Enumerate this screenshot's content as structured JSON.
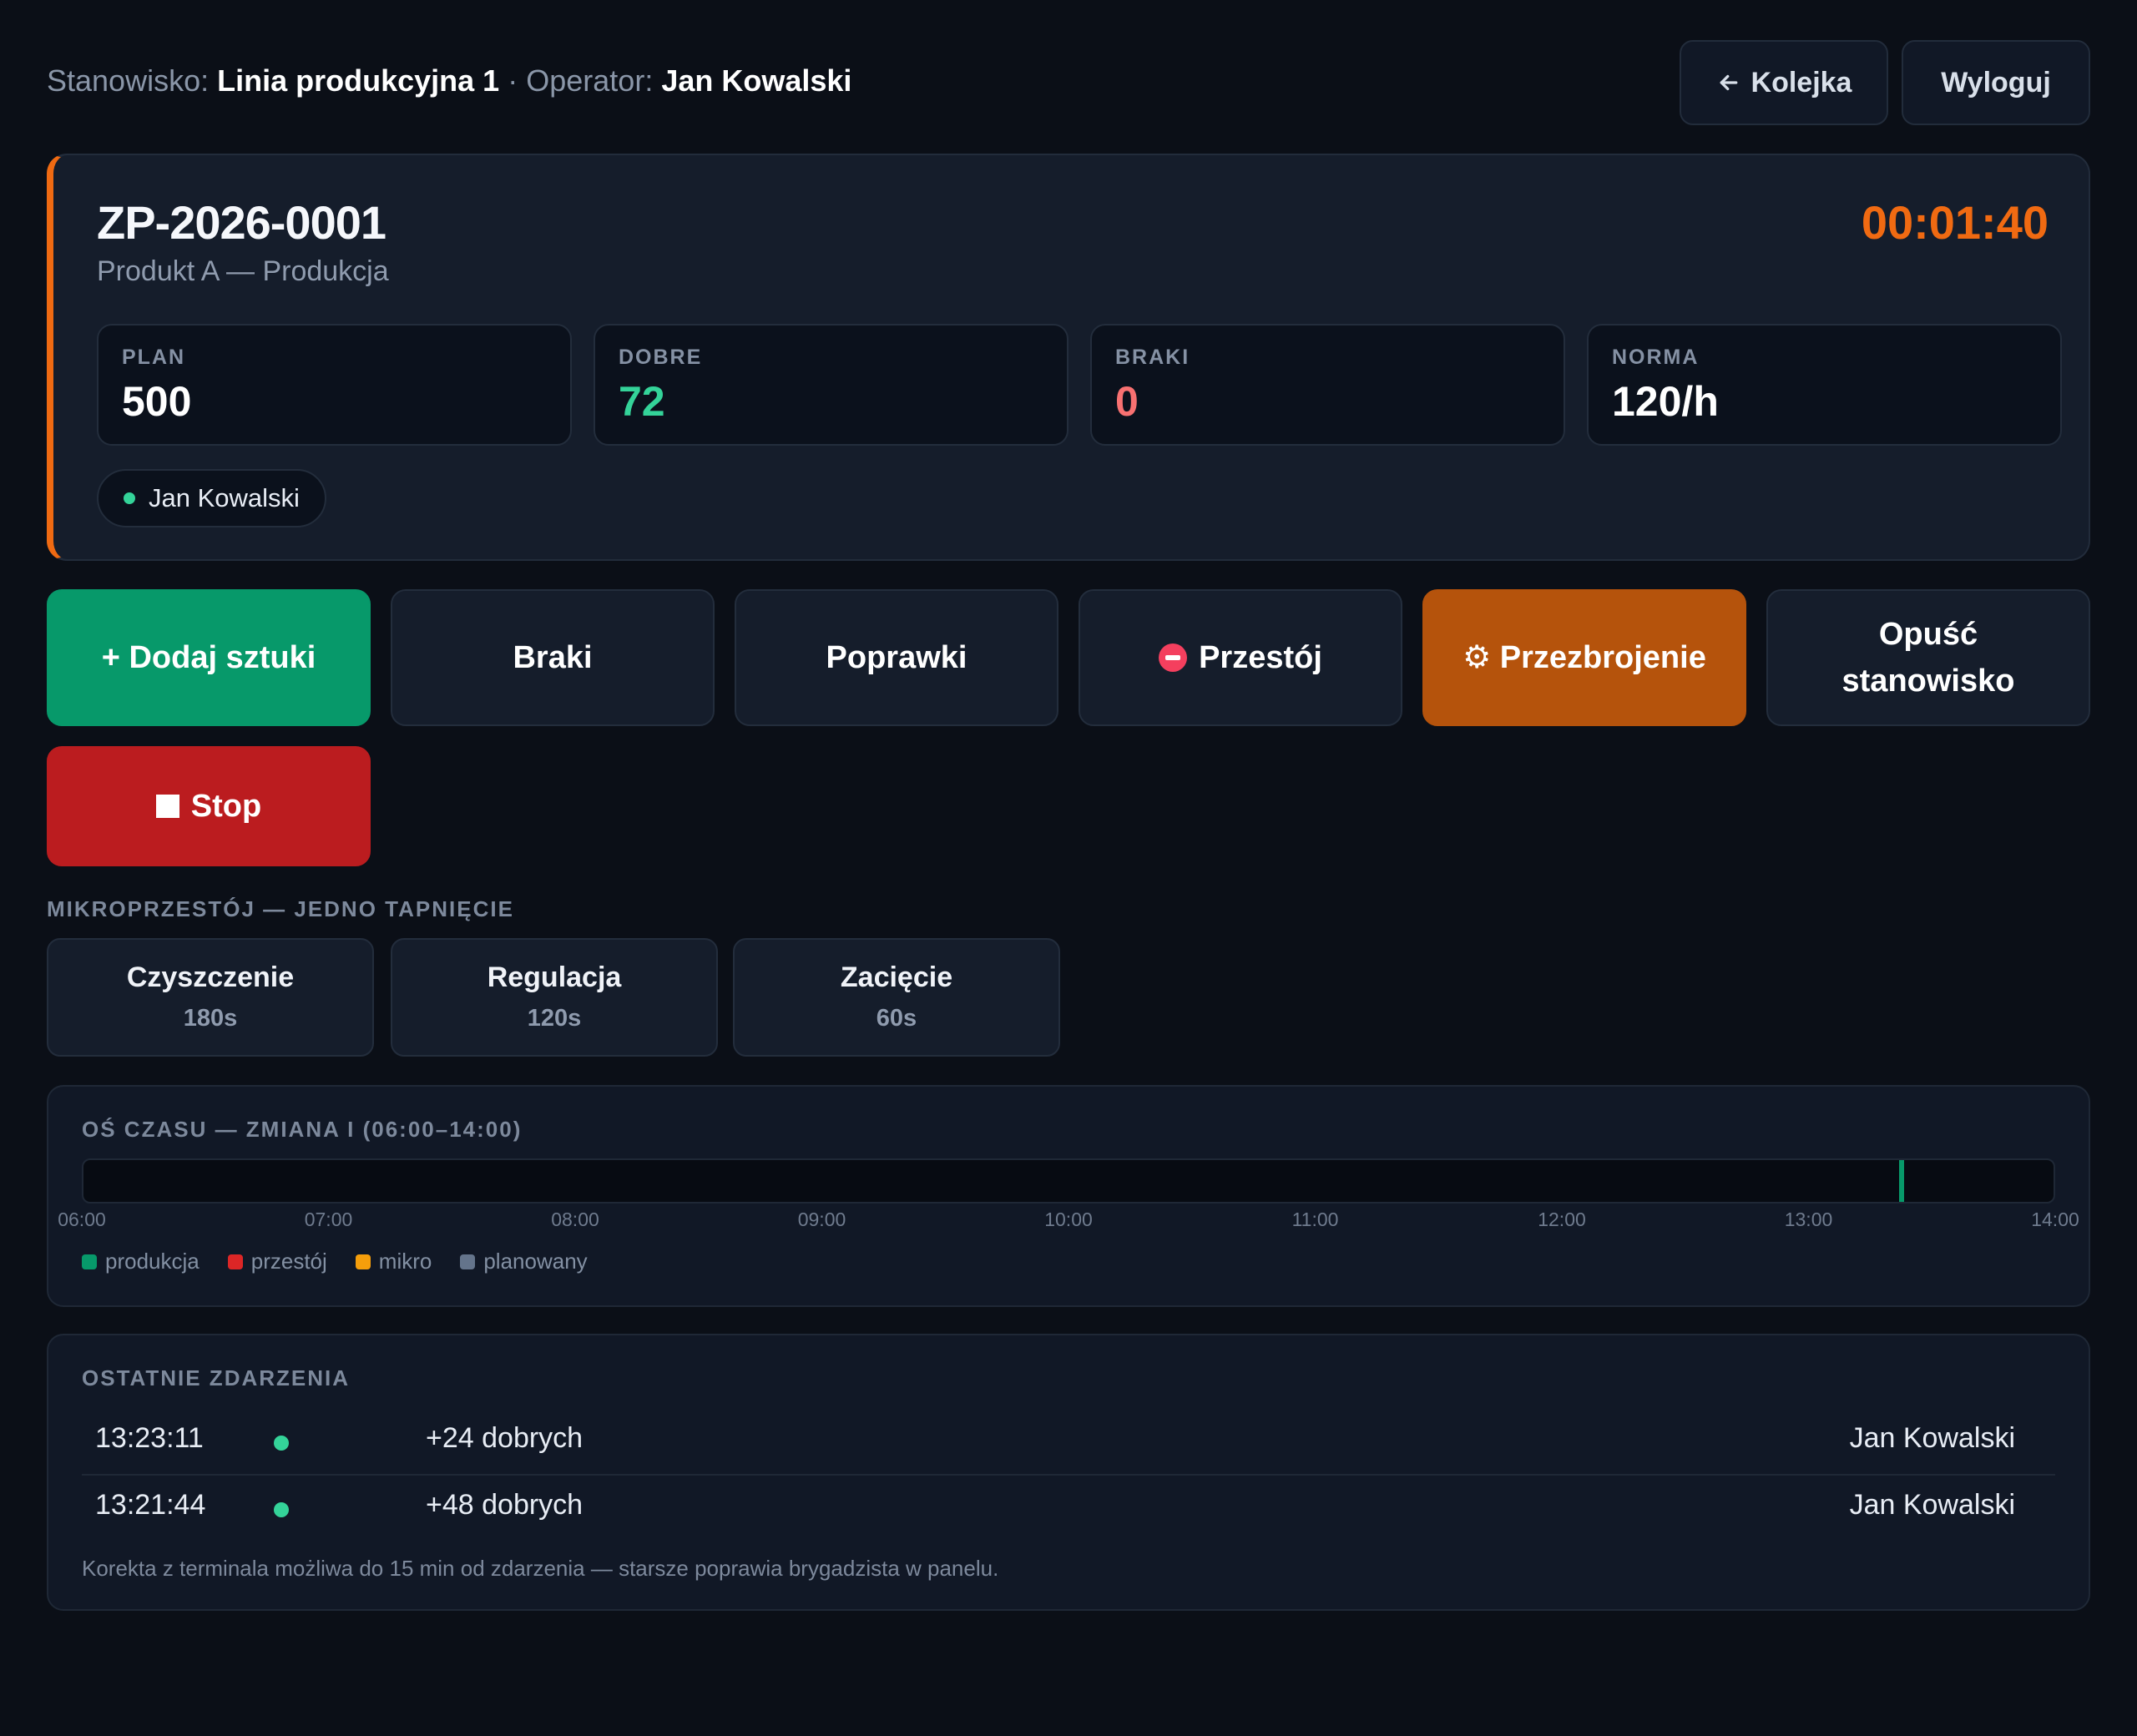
{
  "header": {
    "station_label": "Stanowisko:",
    "station_name": "Linia produkcyjna 1",
    "separator": "·",
    "operator_label": "Operator:",
    "operator_name": "Jan Kowalski",
    "queue_button": "Kolejka",
    "logout_button": "Wyloguj"
  },
  "order": {
    "number": "ZP-2026-0001",
    "subtitle": "Produkt A — Produkcja",
    "timer": "00:01:40",
    "stats": [
      {
        "label": "PLAN",
        "value": "500"
      },
      {
        "label": "DOBRE",
        "value": "72"
      },
      {
        "label": "BRAKI",
        "value": "0"
      },
      {
        "label": "NORMA",
        "value": "120/h"
      }
    ],
    "operator_chip": "Jan Kowalski"
  },
  "actions": {
    "add_pieces": "+ Dodaj sztuki",
    "rejects": "Braki",
    "corrections": "Poprawki",
    "downtime": "Przestój",
    "changeover": "⚙ Przezbrojenie",
    "leave_line1": "Opuść",
    "leave_line2": "stanowisko",
    "stop": "Stop"
  },
  "micro": {
    "title": "MIKROPRZESTÓJ — JEDNO TAPNIĘCIE",
    "items": [
      {
        "name": "Czyszczenie",
        "duration": "180s"
      },
      {
        "name": "Regulacja",
        "duration": "120s"
      },
      {
        "name": "Zacięcie",
        "duration": "60s"
      }
    ]
  },
  "timeline": {
    "title": "OŚ CZASU — ZMIANA I (06:00–14:00)",
    "ticks": [
      "06:00",
      "07:00",
      "08:00",
      "09:00",
      "10:00",
      "11:00",
      "12:00",
      "13:00",
      "14:00"
    ],
    "current_mark_time": "13:23",
    "legend": [
      {
        "label": "produkcja",
        "color": "#07996a"
      },
      {
        "label": "przestój",
        "color": "#dc2626"
      },
      {
        "label": "mikro",
        "color": "#f59e0b"
      },
      {
        "label": "planowany",
        "color": "#64748b"
      }
    ]
  },
  "events": {
    "title": "OSTATNIE ZDARZENIA",
    "rows": [
      {
        "time": "13:23:11",
        "text": "+24 dobrych",
        "user": "Jan Kowalski"
      },
      {
        "time": "13:21:44",
        "text": "+48 dobrych",
        "user": "Jan Kowalski"
      }
    ],
    "note": "Korekta z terminala możliwa do 15 min od zdarzenia — starsze poprawia brygadzista w panelu."
  },
  "colors": {
    "accent_orange": "#f06a12",
    "success": "#34d399",
    "danger": "#bb1c1f"
  }
}
